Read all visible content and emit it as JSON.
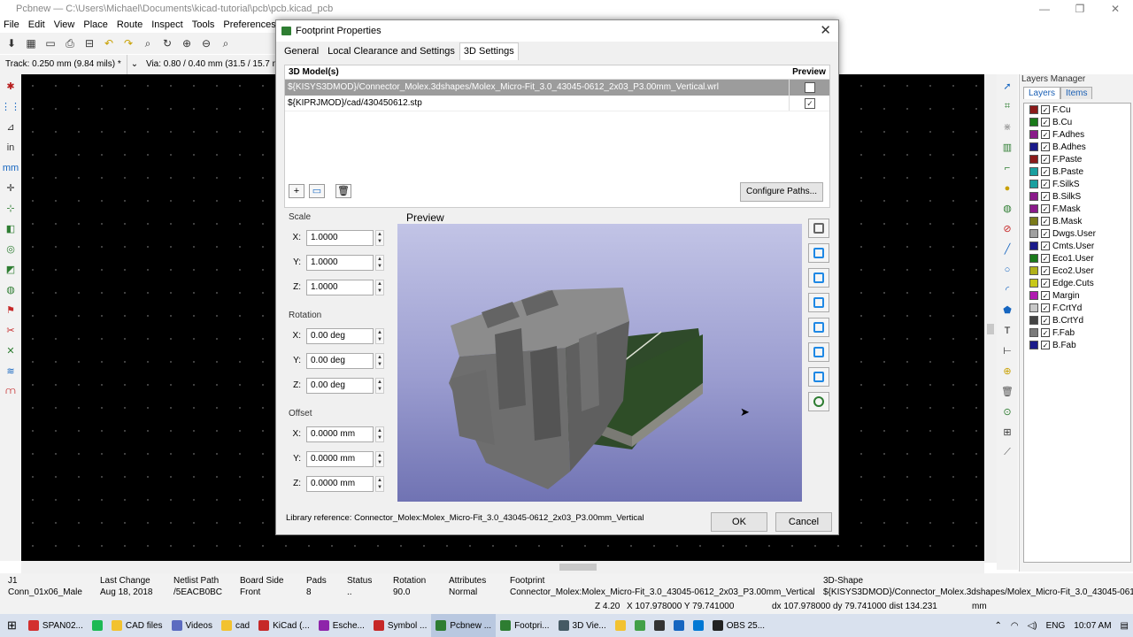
{
  "window": {
    "title": "Pcbnew — C:\\Users\\Michael\\Documents\\kicad-tutorial\\pcb\\pcb.kicad_pcb",
    "min": "—",
    "max": "❐",
    "close": "✕"
  },
  "menu": [
    "File",
    "Edit",
    "View",
    "Place",
    "Route",
    "Inspect",
    "Tools",
    "Preferences",
    "Help"
  ],
  "options": {
    "track": "Track: 0.250 mm (9.84 mils) *",
    "via": "Via: 0.80 / 0.40 mm (31.5 / 15.7 mils"
  },
  "left_tools": [
    {
      "icon": "bug-icon",
      "glyph": "✱",
      "color": "#b71c1c"
    },
    {
      "icon": "grid-icon",
      "glyph": "⋮⋮",
      "color": "#1565c0"
    },
    {
      "icon": "polar-coords-icon",
      "glyph": "⊿",
      "color": "#333"
    },
    {
      "icon": "inch-units-icon",
      "glyph": "in",
      "color": "#333"
    },
    {
      "icon": "mm-units-icon",
      "glyph": "mm",
      "color": "#1565c0"
    },
    {
      "icon": "cursor-shape-icon",
      "glyph": "✛",
      "color": "#333"
    },
    {
      "icon": "ratsnest-icon",
      "glyph": "⊹",
      "color": "#2e7d32"
    },
    {
      "icon": "show-pads-icon",
      "glyph": "◧",
      "color": "#2e7d32"
    },
    {
      "icon": "show-vias-icon",
      "glyph": "◎",
      "color": "#2e7d32"
    },
    {
      "icon": "track-sketch-icon",
      "glyph": "◩",
      "color": "#2e7d32"
    },
    {
      "icon": "zone-fill-icon",
      "glyph": "◍",
      "color": "#2e7d32"
    },
    {
      "icon": "high-contrast-icon",
      "glyph": "⚑",
      "color": "#c62828"
    },
    {
      "icon": "net-highlight-icon",
      "glyph": "✂",
      "color": "#c62828"
    },
    {
      "icon": "microwave-icon",
      "glyph": "✕",
      "color": "#2e7d32"
    },
    {
      "icon": "layers-icon",
      "glyph": "≋",
      "color": "#1565c0"
    },
    {
      "icon": "meander-icon",
      "glyph": "⩋",
      "color": "#c62828"
    }
  ],
  "right_tools": [
    {
      "icon": "select-arrow-icon",
      "glyph": "➚",
      "color": "#1565c0"
    },
    {
      "icon": "highlight-net-icon",
      "glyph": "⌗",
      "color": "#2e7d32"
    },
    {
      "icon": "local-ratsnest-icon",
      "glyph": "⋇",
      "color": "#999"
    },
    {
      "icon": "add-footprint-icon",
      "glyph": "▥",
      "color": "#2e7d32"
    },
    {
      "icon": "route-track-icon",
      "glyph": "⌐",
      "color": "#2e7d32"
    },
    {
      "icon": "add-via-icon",
      "glyph": "●",
      "color": "#c8a000"
    },
    {
      "icon": "add-zone-icon",
      "glyph": "◍",
      "color": "#2e7d32"
    },
    {
      "icon": "keepout-icon",
      "glyph": "⊘",
      "color": "#c62828"
    },
    {
      "icon": "add-line-icon",
      "glyph": "╱",
      "color": "#1565c0"
    },
    {
      "icon": "add-circle-icon",
      "glyph": "○",
      "color": "#1565c0"
    },
    {
      "icon": "add-arc-icon",
      "glyph": "◜",
      "color": "#1565c0"
    },
    {
      "icon": "add-polygon-icon",
      "glyph": "⬟",
      "color": "#1565c0"
    },
    {
      "icon": "add-text-icon",
      "glyph": "T",
      "color": "#222"
    },
    {
      "icon": "add-dimension-icon",
      "glyph": "⊢",
      "color": "#222"
    },
    {
      "icon": "add-target-icon",
      "glyph": "⊕",
      "color": "#c8a000"
    },
    {
      "icon": "delete-icon",
      "glyph": "🗑",
      "color": "#555"
    },
    {
      "icon": "set-origin-icon",
      "glyph": "⊙",
      "color": "#2e7d32"
    },
    {
      "icon": "grid-origin-icon",
      "glyph": "⊞",
      "color": "#333"
    },
    {
      "icon": "measure-icon",
      "glyph": "⟋",
      "color": "#555"
    }
  ],
  "layers_panel": {
    "title": "Layers Manager",
    "tabs": [
      "Layers",
      "Items"
    ],
    "layers": [
      {
        "name": "F.Cu",
        "color": "#8b1a1a"
      },
      {
        "name": "B.Cu",
        "color": "#1a7a1a"
      },
      {
        "name": "F.Adhes",
        "color": "#8a1a8a"
      },
      {
        "name": "B.Adhes",
        "color": "#1a1a8a"
      },
      {
        "name": "F.Paste",
        "color": "#8b1a1a"
      },
      {
        "name": "B.Paste",
        "color": "#1aa0a0"
      },
      {
        "name": "F.SilkS",
        "color": "#1aa0a0"
      },
      {
        "name": "B.SilkS",
        "color": "#8a1a8a"
      },
      {
        "name": "F.Mask",
        "color": "#8a1a8a"
      },
      {
        "name": "B.Mask",
        "color": "#7a7a1a"
      },
      {
        "name": "Dwgs.User",
        "color": "#a0a0a0"
      },
      {
        "name": "Cmts.User",
        "color": "#1a1a8a"
      },
      {
        "name": "Eco1.User",
        "color": "#1a7a1a"
      },
      {
        "name": "Eco2.User",
        "color": "#b0b01a"
      },
      {
        "name": "Edge.Cuts",
        "color": "#c8c81a"
      },
      {
        "name": "Margin",
        "color": "#b01ab0"
      },
      {
        "name": "F.CrtYd",
        "color": "#c8c8c8"
      },
      {
        "name": "B.CrtYd",
        "color": "#444444"
      },
      {
        "name": "F.Fab",
        "color": "#7a7a7a"
      },
      {
        "name": "B.Fab",
        "color": "#1a1a8a"
      }
    ]
  },
  "dialog": {
    "title": "Footprint Properties",
    "close": "✕",
    "tabs": [
      "General",
      "Local Clearance and Settings",
      "3D Settings"
    ],
    "table": {
      "col_model": "3D Model(s)",
      "col_preview": "Preview",
      "rows": [
        {
          "path": "${KISYS3DMOD}/Connector_Molex.3dshapes/Molex_Micro-Fit_3.0_43045-0612_2x03_P3.00mm_Vertical.wrl",
          "checked": ""
        },
        {
          "path": "${KIPRJMOD}/cad/430450612.stp",
          "checked": "✓"
        }
      ]
    },
    "buttons": {
      "add": "+",
      "browse": "▭",
      "delete": "🗑",
      "configure": "Configure Paths...",
      "ok": "OK",
      "cancel": "Cancel"
    },
    "scale": {
      "label": "Scale",
      "x_label": "X:",
      "x": "1.0000",
      "y_label": "Y:",
      "y": "1.0000",
      "z_label": "Z:",
      "z": "1.0000"
    },
    "rotation": {
      "label": "Rotation",
      "x_label": "X:",
      "x": "0.00 deg",
      "y_label": "Y:",
      "y": "0.00 deg",
      "z_label": "Z:",
      "z": "0.00 deg"
    },
    "offset": {
      "label": "Offset",
      "x_label": "X:",
      "x": "0.0000 mm",
      "y_label": "Y:",
      "y": "0.0000 mm",
      "z_label": "Z:",
      "z": "0.0000 mm"
    },
    "preview_label": "Preview",
    "view_buttons": [
      "view-3d-icon",
      "view-front-icon",
      "view-back-icon",
      "view-left-icon",
      "view-right-icon",
      "view-top-icon",
      "view-bottom-icon",
      "reload-icon"
    ],
    "library_ref": "Library reference: Connector_Molex:Molex_Micro-Fit_3.0_43045-0612_2x03_P3.00mm_Vertical"
  },
  "status": {
    "ref": "J1",
    "value": "Conn_01x06_Male",
    "last_change_label": "Last Change",
    "last_change": "Aug 18, 2018",
    "netlist_label": "Netlist Path",
    "netlist": "/5EACB0BC",
    "side_label": "Board Side",
    "side": "Front",
    "pads_label": "Pads",
    "pads": "8",
    "status_label": "Status",
    "status": "..",
    "rotation_label": "Rotation",
    "rotation": "90.0",
    "attributes_label": "Attributes",
    "attributes": "Normal",
    "footprint_label": "Footprint",
    "footprint": "Connector_Molex:Molex_Micro-Fit_3.0_43045-0612_2x03_P3.00mm_Vertical",
    "shape_label": "3D-Shape",
    "shape": "${KISYS3DMOD}/Connector_Molex.3dshapes/Molex_Micro-Fit_3.0_43045-0612_"
  },
  "coords": {
    "z": "Z 4.20",
    "xy": "X 107.978000  Y 79.741000",
    "dxy": "dx 107.978000  dy 79.741000  dist 134.231",
    "units": "mm"
  },
  "taskbar": {
    "items": [
      {
        "label": "SPAN02...",
        "color": "#d32f2f",
        "icon": "brave-icon"
      },
      {
        "label": "",
        "color": "#1db954",
        "icon": "spotify-icon"
      },
      {
        "label": "CAD files",
        "color": "#f2c230",
        "icon": "folder-icon"
      },
      {
        "label": "Videos",
        "color": "#5c6bc0",
        "icon": "video-app-icon"
      },
      {
        "label": "cad",
        "color": "#f2c230",
        "icon": "folder-icon"
      },
      {
        "label": "KiCad (...",
        "color": "#c62828",
        "icon": "kicad-icon"
      },
      {
        "label": "Esche...",
        "color": "#8e24aa",
        "icon": "eeschema-icon"
      },
      {
        "label": "Symbol ...",
        "color": "#c62828",
        "icon": "symbol-editor-icon"
      },
      {
        "label": "Pcbnew ...",
        "color": "#2e7d32",
        "icon": "pcbnew-icon"
      },
      {
        "label": "Footpri...",
        "color": "#2e7d32",
        "icon": "footprint-editor-icon"
      },
      {
        "label": "3D Vie...",
        "color": "#455a64",
        "icon": "3d-viewer-icon"
      },
      {
        "label": "",
        "color": "#f2c230",
        "icon": "file-explorer-icon"
      },
      {
        "label": "",
        "color": "#43a047",
        "icon": "chrome-icon"
      },
      {
        "label": "",
        "color": "#333333",
        "icon": "github-icon"
      },
      {
        "label": "",
        "color": "#1565c0",
        "icon": "camera-icon"
      },
      {
        "label": "",
        "color": "#0078d4",
        "icon": "vscode-icon"
      },
      {
        "label": "OBS 25...",
        "color": "#222222",
        "icon": "obs-icon"
      }
    ],
    "lang": "ENG",
    "time": "10:07 AM"
  }
}
